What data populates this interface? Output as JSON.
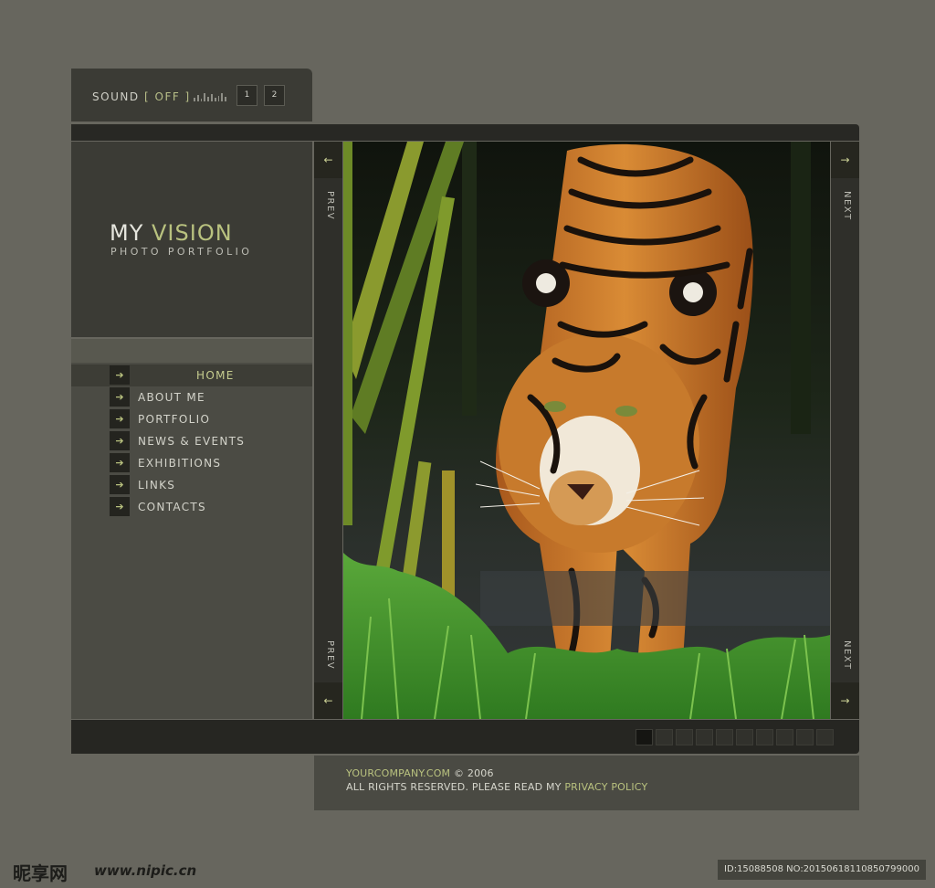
{
  "colors": {
    "background": "#67665e",
    "panel": "#3b3b35",
    "accent": "#b9c27f"
  },
  "sound": {
    "label": "SOUND",
    "state": "[ OFF ]",
    "tracks": [
      "1",
      "2"
    ]
  },
  "logo": {
    "title_my": "MY",
    "title_vision": "VISION",
    "subtitle": "PHOTO PORTFOLIO"
  },
  "menu": {
    "items": [
      {
        "label": "HOME",
        "icon": "arrow-right-icon",
        "active": true
      },
      {
        "label": "ABOUT ME",
        "icon": "arrow-right-icon"
      },
      {
        "label": "PORTFOLIO",
        "icon": "arrow-right-icon"
      },
      {
        "label": "NEWS & EVENTS",
        "icon": "arrow-right-icon"
      },
      {
        "label": "EXHIBITIONS",
        "icon": "arrow-right-icon"
      },
      {
        "label": "LINKS",
        "icon": "arrow-right-icon"
      },
      {
        "label": "CONTACTS",
        "icon": "arrow-right-icon"
      }
    ]
  },
  "gallery": {
    "prev_label": "PREV",
    "next_label": "NEXT",
    "page_count": 10,
    "current_page": 1
  },
  "footer": {
    "company": "YOURCOMPANY.COM",
    "copyright": "© 2006",
    "rights": "ALL RIGHTS RESERVED. PLEASE READ MY",
    "privacy": "PRIVACY POLICY"
  },
  "watermark": {
    "logo": "昵享网",
    "url": "www.nipic.cn",
    "id": "ID:15088508 NO:20150618110850799000"
  }
}
